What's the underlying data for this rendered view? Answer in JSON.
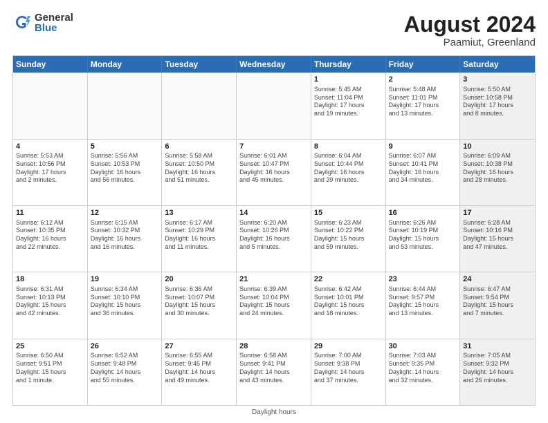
{
  "logo": {
    "general": "General",
    "blue": "Blue"
  },
  "title": "August 2024",
  "location": "Paamiut, Greenland",
  "days": [
    "Sunday",
    "Monday",
    "Tuesday",
    "Wednesday",
    "Thursday",
    "Friday",
    "Saturday"
  ],
  "footer": "Daylight hours",
  "weeks": [
    [
      {
        "day": "",
        "info": "",
        "empty": true
      },
      {
        "day": "",
        "info": "",
        "empty": true
      },
      {
        "day": "",
        "info": "",
        "empty": true
      },
      {
        "day": "",
        "info": "",
        "empty": true
      },
      {
        "day": "1",
        "info": "Sunrise: 5:45 AM\nSunset: 11:04 PM\nDaylight: 17 hours\nand 19 minutes."
      },
      {
        "day": "2",
        "info": "Sunrise: 5:48 AM\nSunset: 11:01 PM\nDaylight: 17 hours\nand 13 minutes."
      },
      {
        "day": "3",
        "info": "Sunrise: 5:50 AM\nSunset: 10:58 PM\nDaylight: 17 hours\nand 8 minutes.",
        "shaded": true
      }
    ],
    [
      {
        "day": "4",
        "info": "Sunrise: 5:53 AM\nSunset: 10:56 PM\nDaylight: 17 hours\nand 2 minutes."
      },
      {
        "day": "5",
        "info": "Sunrise: 5:56 AM\nSunset: 10:53 PM\nDaylight: 16 hours\nand 56 minutes."
      },
      {
        "day": "6",
        "info": "Sunrise: 5:58 AM\nSunset: 10:50 PM\nDaylight: 16 hours\nand 51 minutes."
      },
      {
        "day": "7",
        "info": "Sunrise: 6:01 AM\nSunset: 10:47 PM\nDaylight: 16 hours\nand 45 minutes."
      },
      {
        "day": "8",
        "info": "Sunrise: 6:04 AM\nSunset: 10:44 PM\nDaylight: 16 hours\nand 39 minutes."
      },
      {
        "day": "9",
        "info": "Sunrise: 6:07 AM\nSunset: 10:41 PM\nDaylight: 16 hours\nand 34 minutes."
      },
      {
        "day": "10",
        "info": "Sunrise: 6:09 AM\nSunset: 10:38 PM\nDaylight: 16 hours\nand 28 minutes.",
        "shaded": true
      }
    ],
    [
      {
        "day": "11",
        "info": "Sunrise: 6:12 AM\nSunset: 10:35 PM\nDaylight: 16 hours\nand 22 minutes."
      },
      {
        "day": "12",
        "info": "Sunrise: 6:15 AM\nSunset: 10:32 PM\nDaylight: 16 hours\nand 16 minutes."
      },
      {
        "day": "13",
        "info": "Sunrise: 6:17 AM\nSunset: 10:29 PM\nDaylight: 16 hours\nand 11 minutes."
      },
      {
        "day": "14",
        "info": "Sunrise: 6:20 AM\nSunset: 10:26 PM\nDaylight: 16 hours\nand 5 minutes."
      },
      {
        "day": "15",
        "info": "Sunrise: 6:23 AM\nSunset: 10:22 PM\nDaylight: 15 hours\nand 59 minutes."
      },
      {
        "day": "16",
        "info": "Sunrise: 6:26 AM\nSunset: 10:19 PM\nDaylight: 15 hours\nand 53 minutes."
      },
      {
        "day": "17",
        "info": "Sunrise: 6:28 AM\nSunset: 10:16 PM\nDaylight: 15 hours\nand 47 minutes.",
        "shaded": true
      }
    ],
    [
      {
        "day": "18",
        "info": "Sunrise: 6:31 AM\nSunset: 10:13 PM\nDaylight: 15 hours\nand 42 minutes."
      },
      {
        "day": "19",
        "info": "Sunrise: 6:34 AM\nSunset: 10:10 PM\nDaylight: 15 hours\nand 36 minutes."
      },
      {
        "day": "20",
        "info": "Sunrise: 6:36 AM\nSunset: 10:07 PM\nDaylight: 15 hours\nand 30 minutes."
      },
      {
        "day": "21",
        "info": "Sunrise: 6:39 AM\nSunset: 10:04 PM\nDaylight: 15 hours\nand 24 minutes."
      },
      {
        "day": "22",
        "info": "Sunrise: 6:42 AM\nSunset: 10:01 PM\nDaylight: 15 hours\nand 18 minutes."
      },
      {
        "day": "23",
        "info": "Sunrise: 6:44 AM\nSunset: 9:57 PM\nDaylight: 15 hours\nand 13 minutes."
      },
      {
        "day": "24",
        "info": "Sunrise: 6:47 AM\nSunset: 9:54 PM\nDaylight: 15 hours\nand 7 minutes.",
        "shaded": true
      }
    ],
    [
      {
        "day": "25",
        "info": "Sunrise: 6:50 AM\nSunset: 9:51 PM\nDaylight: 15 hours\nand 1 minute."
      },
      {
        "day": "26",
        "info": "Sunrise: 6:52 AM\nSunset: 9:48 PM\nDaylight: 14 hours\nand 55 minutes."
      },
      {
        "day": "27",
        "info": "Sunrise: 6:55 AM\nSunset: 9:45 PM\nDaylight: 14 hours\nand 49 minutes."
      },
      {
        "day": "28",
        "info": "Sunrise: 6:58 AM\nSunset: 9:41 PM\nDaylight: 14 hours\nand 43 minutes."
      },
      {
        "day": "29",
        "info": "Sunrise: 7:00 AM\nSunset: 9:38 PM\nDaylight: 14 hours\nand 37 minutes."
      },
      {
        "day": "30",
        "info": "Sunrise: 7:03 AM\nSunset: 9:35 PM\nDaylight: 14 hours\nand 32 minutes."
      },
      {
        "day": "31",
        "info": "Sunrise: 7:05 AM\nSunset: 9:32 PM\nDaylight: 14 hours\nand 26 minutes.",
        "shaded": true
      }
    ]
  ]
}
